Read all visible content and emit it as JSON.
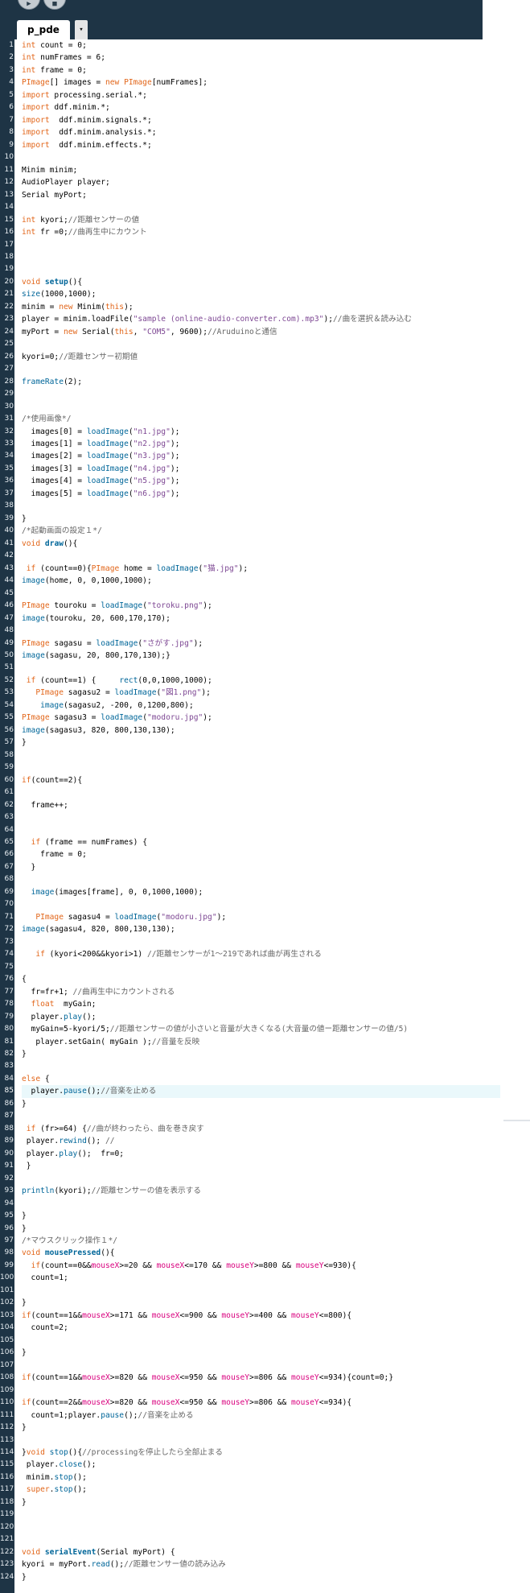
{
  "toolbar": {
    "run_icon": "play-triangle",
    "stop_icon": "stop-square"
  },
  "tab": {
    "label": "p_pde",
    "menu_icon": "▾"
  },
  "editor": {
    "highlighted_line": 85,
    "lines": [
      {
        "n": "1",
        "t": "int count = 0;"
      },
      {
        "n": "2",
        "t": "int numFrames = 6;"
      },
      {
        "n": "3",
        "t": "int frame = 0;"
      },
      {
        "n": "4",
        "t": "PImage[] images = new PImage[numFrames];"
      },
      {
        "n": "5",
        "t": "import processing.serial.*;"
      },
      {
        "n": "6",
        "t": "import ddf.minim.*;"
      },
      {
        "n": "7",
        "t": "import  ddf.minim.signals.*;"
      },
      {
        "n": "8",
        "t": "import  ddf.minim.analysis.*;"
      },
      {
        "n": "9",
        "t": "import  ddf.minim.effects.*;"
      },
      {
        "n": "10",
        "t": ""
      },
      {
        "n": "11",
        "t": "Minim minim;"
      },
      {
        "n": "12",
        "t": "AudioPlayer player;"
      },
      {
        "n": "13",
        "t": "Serial myPort;"
      },
      {
        "n": "14",
        "t": ""
      },
      {
        "n": "15",
        "t": "int kyori;//距離センサーの値"
      },
      {
        "n": "16",
        "t": "int fr =0;//曲再生中にカウント"
      },
      {
        "n": "17",
        "t": ""
      },
      {
        "n": "18",
        "t": ""
      },
      {
        "n": "19",
        "t": ""
      },
      {
        "n": "20",
        "t": "void setup(){"
      },
      {
        "n": "21",
        "t": "size(1000,1000);"
      },
      {
        "n": "22",
        "t": "minim = new Minim(this);"
      },
      {
        "n": "23",
        "t": "player = minim.loadFile(\"sample (online-audio-converter.com).mp3\");//曲を選択＆読み込む"
      },
      {
        "n": "24",
        "t": "myPort = new Serial(this, \"COM5\", 9600);//Aruduinoと通信"
      },
      {
        "n": "25",
        "t": ""
      },
      {
        "n": "26",
        "t": "kyori=0;//距離センサー初期値"
      },
      {
        "n": "27",
        "t": ""
      },
      {
        "n": "28",
        "t": "frameRate(2);"
      },
      {
        "n": "29",
        "t": ""
      },
      {
        "n": "30",
        "t": ""
      },
      {
        "n": "31",
        "t": "/*使用画像*/"
      },
      {
        "n": "32",
        "t": "  images[0] = loadImage(\"n1.jpg\");"
      },
      {
        "n": "33",
        "t": "  images[1] = loadImage(\"n2.jpg\");"
      },
      {
        "n": "34",
        "t": "  images[2] = loadImage(\"n3.jpg\");"
      },
      {
        "n": "35",
        "t": "  images[3] = loadImage(\"n4.jpg\");"
      },
      {
        "n": "36",
        "t": "  images[4] = loadImage(\"n5.jpg\");"
      },
      {
        "n": "37",
        "t": "  images[5] = loadImage(\"n6.jpg\");"
      },
      {
        "n": "38",
        "t": ""
      },
      {
        "n": "39",
        "t": "}"
      },
      {
        "n": "40",
        "t": "/*起動画面の設定１*/"
      },
      {
        "n": "41",
        "t": "void draw(){"
      },
      {
        "n": "42",
        "t": ""
      },
      {
        "n": "43",
        "t": " if (count==0){PImage home = loadImage(\"猫.jpg\");"
      },
      {
        "n": "44",
        "t": "image(home, 0, 0,1000,1000);"
      },
      {
        "n": "45",
        "t": ""
      },
      {
        "n": "46",
        "t": "PImage touroku = loadImage(\"toroku.png\");"
      },
      {
        "n": "47",
        "t": "image(touroku, 20, 600,170,170);"
      },
      {
        "n": "48",
        "t": ""
      },
      {
        "n": "49",
        "t": "PImage sagasu = loadImage(\"さがす.jpg\");"
      },
      {
        "n": "50",
        "t": "image(sagasu, 20, 800,170,130);}"
      },
      {
        "n": "51",
        "t": ""
      },
      {
        "n": "52",
        "t": " if (count==1) {     rect(0,0,1000,1000);"
      },
      {
        "n": "53",
        "t": "   PImage sagasu2 = loadImage(\"図1.png\");"
      },
      {
        "n": "54",
        "t": "    image(sagasu2, -200, 0,1200,800);"
      },
      {
        "n": "55",
        "t": "PImage sagasu3 = loadImage(\"modoru.jpg\");"
      },
      {
        "n": "56",
        "t": "image(sagasu3, 820, 800,130,130);"
      },
      {
        "n": "57",
        "t": "}"
      },
      {
        "n": "58",
        "t": ""
      },
      {
        "n": "59",
        "t": ""
      },
      {
        "n": "60",
        "t": "if(count==2){"
      },
      {
        "n": "61",
        "t": ""
      },
      {
        "n": "62",
        "t": "  frame++;"
      },
      {
        "n": "63",
        "t": ""
      },
      {
        "n": "64",
        "t": ""
      },
      {
        "n": "65",
        "t": "  if (frame == numFrames) {"
      },
      {
        "n": "66",
        "t": "    frame = 0;"
      },
      {
        "n": "67",
        "t": "  }"
      },
      {
        "n": "68",
        "t": ""
      },
      {
        "n": "69",
        "t": "  image(images[frame], 0, 0,1000,1000);"
      },
      {
        "n": "70",
        "t": ""
      },
      {
        "n": "71",
        "t": "   PImage sagasu4 = loadImage(\"modoru.jpg\");"
      },
      {
        "n": "72",
        "t": "image(sagasu4, 820, 800,130,130);"
      },
      {
        "n": "73",
        "t": ""
      },
      {
        "n": "74",
        "t": "   if (kyori<200&&kyori>1) //距離センサーが1〜219であれば曲が再生される"
      },
      {
        "n": "75",
        "t": ""
      },
      {
        "n": "76",
        "t": "{"
      },
      {
        "n": "77",
        "t": "  fr=fr+1; //曲再生中にカウントされる"
      },
      {
        "n": "78",
        "t": "  float  myGain;"
      },
      {
        "n": "79",
        "t": "  player.play();"
      },
      {
        "n": "80",
        "t": "  myGain=5-kyori/5;//距離センサーの値が小さいと音量が大きくなる(大音量の値ー距離センサーの値/5)"
      },
      {
        "n": "81",
        "t": "   player.setGain( myGain );//音量を反映"
      },
      {
        "n": "82",
        "t": "}"
      },
      {
        "n": "83",
        "t": ""
      },
      {
        "n": "84",
        "t": "else {"
      },
      {
        "n": "85",
        "t": "  player.pause();//音楽を止める"
      },
      {
        "n": "86",
        "t": "}"
      },
      {
        "n": "87",
        "t": ""
      },
      {
        "n": "88",
        "t": " if (fr>=64) {//曲が終わったら、曲を巻き戻す"
      },
      {
        "n": "89",
        "t": " player.rewind(); //"
      },
      {
        "n": "90",
        "t": " player.play();  fr=0;"
      },
      {
        "n": "91",
        "t": " }"
      },
      {
        "n": "92",
        "t": ""
      },
      {
        "n": "93",
        "t": "println(kyori);//距離センサーの値を表示する"
      },
      {
        "n": "94",
        "t": ""
      },
      {
        "n": "95",
        "t": "}"
      },
      {
        "n": "96",
        "t": "}"
      },
      {
        "n": "97",
        "t": "/*マウスクリック操作１*/"
      },
      {
        "n": "98",
        "t": "void mousePressed(){"
      },
      {
        "n": "99",
        "t": "  if(count==0&&mouseX>=20 && mouseX<=170 && mouseY>=800 && mouseY<=930){"
      },
      {
        "n": "100",
        "t": "  count=1;"
      },
      {
        "n": "101",
        "t": ""
      },
      {
        "n": "102",
        "t": "}"
      },
      {
        "n": "103",
        "t": "if(count==1&&mouseX>=171 && mouseX<=900 && mouseY>=400 && mouseY<=800){"
      },
      {
        "n": "104",
        "t": "  count=2;"
      },
      {
        "n": "105",
        "t": ""
      },
      {
        "n": "106",
        "t": "}"
      },
      {
        "n": "107",
        "t": ""
      },
      {
        "n": "108",
        "t": "if(count==1&&mouseX>=820 && mouseX<=950 && mouseY>=806 && mouseY<=934){count=0;}"
      },
      {
        "n": "109",
        "t": ""
      },
      {
        "n": "110",
        "t": "if(count==2&&mouseX>=820 && mouseX<=950 && mouseY>=806 && mouseY<=934){"
      },
      {
        "n": "111",
        "t": "  count=1;player.pause();//音楽を止める"
      },
      {
        "n": "112",
        "t": "}"
      },
      {
        "n": "113",
        "t": ""
      },
      {
        "n": "114",
        "t": "}void stop(){//processingを停止したら全部止まる"
      },
      {
        "n": "115",
        "t": " player.close();"
      },
      {
        "n": "116",
        "t": " minim.stop();"
      },
      {
        "n": "117",
        "t": " super.stop();"
      },
      {
        "n": "118",
        "t": "}"
      },
      {
        "n": "119",
        "t": ""
      },
      {
        "n": "120",
        "t": ""
      },
      {
        "n": "121",
        "t": ""
      },
      {
        "n": "122",
        "t": "void serialEvent(Serial myPort) {"
      },
      {
        "n": "123",
        "t": "kyori = myPort.read();//距離センサー値の読み込み"
      },
      {
        "n": "124",
        "t": "}"
      }
    ]
  }
}
